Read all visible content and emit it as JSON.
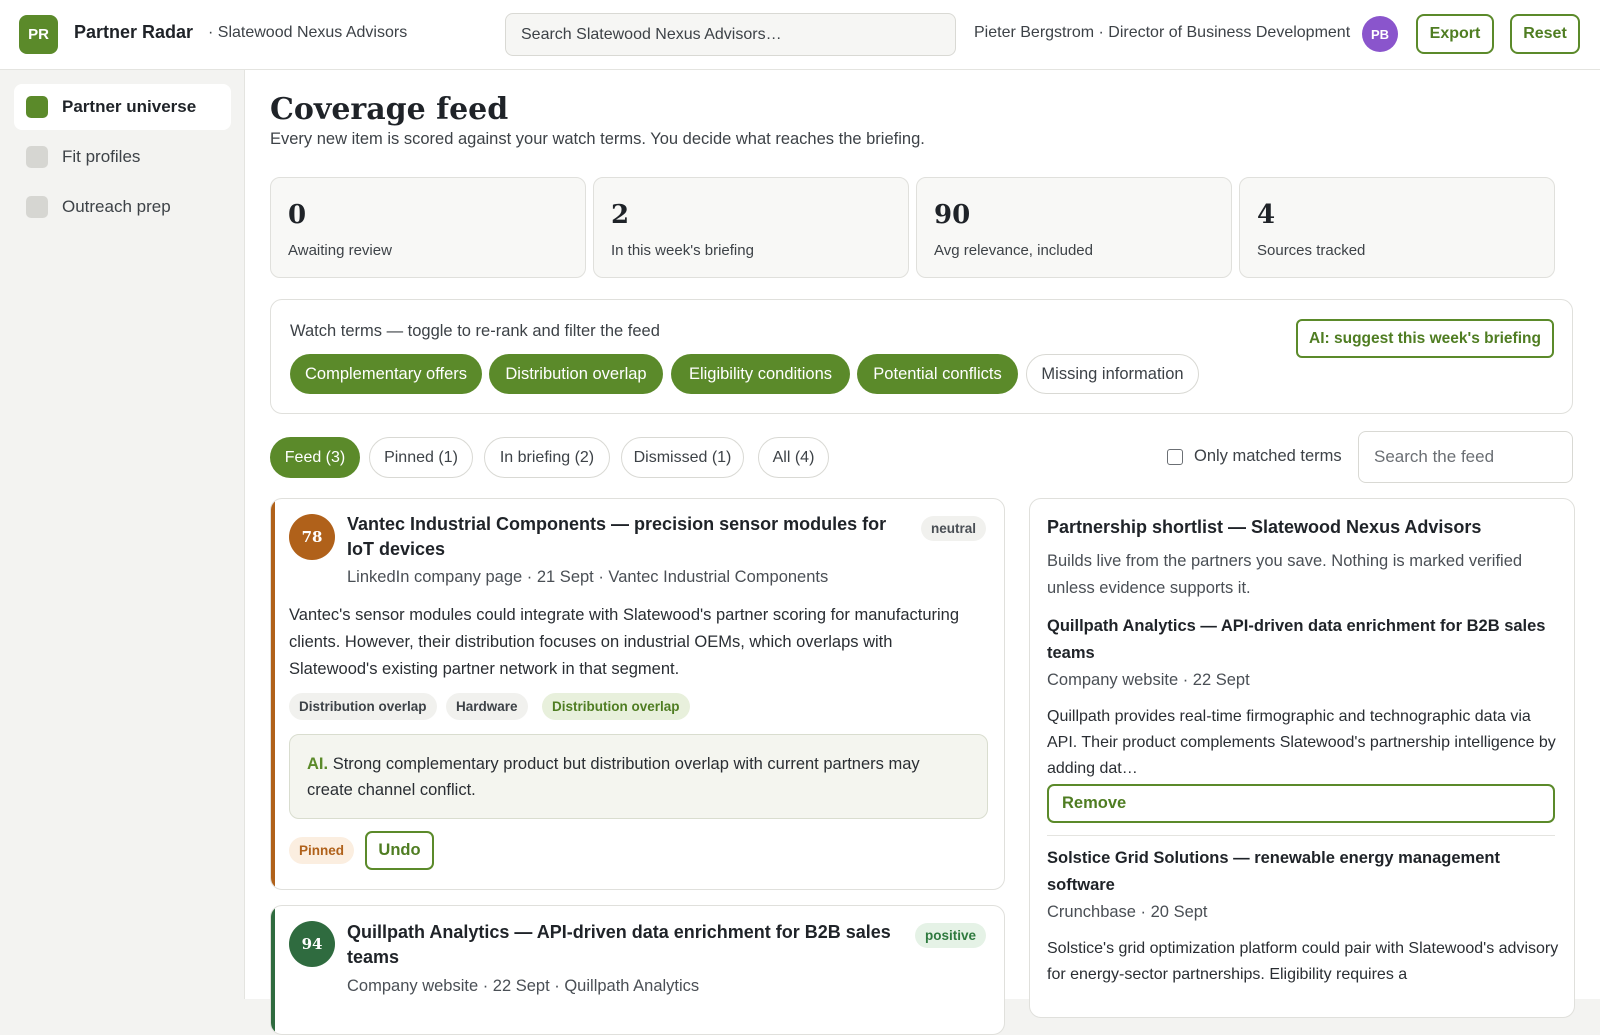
{
  "app": {
    "logo_text": "PR",
    "title": "Partner Radar",
    "subtitle": "· Slatewood Nexus Advisors"
  },
  "header": {
    "search_placeholder": "Search Slatewood Nexus Advisors…",
    "user_label": "Pieter Bergstrom · Director of Business Development",
    "avatar_initials": "PB",
    "export_label": "Export",
    "reset_label": "Reset"
  },
  "sidebar": {
    "items": [
      {
        "label": "Partner universe",
        "active": true
      },
      {
        "label": "Fit profiles",
        "active": false
      },
      {
        "label": "Outreach prep",
        "active": false
      }
    ]
  },
  "main": {
    "title": "Coverage feed",
    "description": "Every new item is scored against your watch terms. You decide what reaches the briefing."
  },
  "stats": [
    {
      "value": "0",
      "label": "Awaiting review"
    },
    {
      "value": "2",
      "label": "In this week's briefing"
    },
    {
      "value": "90",
      "label": "Avg relevance, included"
    },
    {
      "value": "4",
      "label": "Sources tracked"
    }
  ],
  "watch_terms": {
    "label": "Watch terms — toggle to re-rank and filter the feed",
    "ai_button": "AI: suggest this week's briefing",
    "terms": [
      {
        "label": "Complementary offers",
        "on": true
      },
      {
        "label": "Distribution overlap",
        "on": true
      },
      {
        "label": "Eligibility conditions",
        "on": true
      },
      {
        "label": "Potential conflicts",
        "on": true
      },
      {
        "label": "Missing information",
        "on": false
      }
    ]
  },
  "tabs": [
    {
      "label": "Feed (3)",
      "active": true
    },
    {
      "label": "Pinned (1)",
      "active": false
    },
    {
      "label": "In briefing (2)",
      "active": false
    },
    {
      "label": "Dismissed (1)",
      "active": false
    },
    {
      "label": "All (4)",
      "active": false
    }
  ],
  "filters": {
    "only_matched_label": "Only matched terms",
    "only_matched_checked": false,
    "feed_search_placeholder": "Search the feed"
  },
  "feed": [
    {
      "score": "78",
      "score_color": "#b0611a",
      "title": "Vantec Industrial Components — precision sensor modules for IoT devices",
      "sentiment": "neutral",
      "meta": "LinkedIn company page · 21 Sept · Vantec Industrial Components",
      "body": "Vantec's sensor modules could integrate with Slatewood's partner scoring for manufacturing clients. However, their distribution focuses on industrial OEMs, which overlaps with Slatewood's existing partner network in that segment.",
      "tags": [
        "Distribution overlap",
        "Hardware",
        "Distribution overlap"
      ],
      "ai_label": "AI.",
      "ai_note": "Strong complementary product but distribution overlap with current partners may create channel conflict.",
      "status": "Pinned",
      "action": "Undo"
    },
    {
      "score": "94",
      "score_color": "#2f6b3f",
      "title": "Quillpath Analytics — API-driven data enrichment for B2B sales teams",
      "sentiment": "positive",
      "meta": "Company website · 22 Sept · Quillpath Analytics"
    }
  ],
  "shortlist": {
    "title": "Partnership shortlist — Slatewood Nexus Advisors",
    "description": "Builds live from the partners you save. Nothing is marked verified unless evidence supports it.",
    "items": [
      {
        "title": "Quillpath Analytics — API-driven data enrichment for B2B sales teams",
        "meta": "Company website · 22 Sept",
        "body": "Quillpath provides real-time firmographic and technographic data via API. Their product complements Slatewood's partnership intelligence by adding dat…",
        "action": "Remove"
      },
      {
        "title": "Solstice Grid Solutions — renewable energy management software",
        "meta": "Crunchbase · 20 Sept",
        "body": "Solstice's grid optimization platform could pair with Slatewood's advisory for energy-sector partnerships. Eligibility requires a"
      }
    ]
  },
  "colors": {
    "accent": "#5b8a2a",
    "score_orange": "#b0611a",
    "score_green": "#2f6b3f",
    "avatar": "#8a55cc"
  }
}
